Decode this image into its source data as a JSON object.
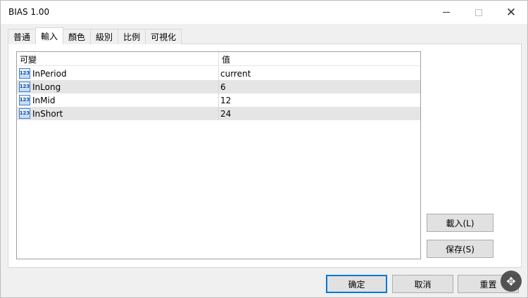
{
  "window": {
    "title": "BIAS 1.00"
  },
  "tabs": [
    {
      "label": "普通"
    },
    {
      "label": "輸入"
    },
    {
      "label": "顏色"
    },
    {
      "label": "級別"
    },
    {
      "label": "比例"
    },
    {
      "label": "可視化"
    }
  ],
  "active_tab": "輸入",
  "grid": {
    "columns": {
      "variable": "可變",
      "value": "值"
    },
    "rows": [
      {
        "icon": "123",
        "name": "InPeriod",
        "value": "current"
      },
      {
        "icon": "123",
        "name": "InLong",
        "value": "6"
      },
      {
        "icon": "123",
        "name": "InMid",
        "value": "12"
      },
      {
        "icon": "123",
        "name": "InShort",
        "value": "24"
      }
    ]
  },
  "side_buttons": {
    "load": "載入(L)",
    "save": "保存(S)"
  },
  "footer_buttons": {
    "ok": "确定",
    "cancel": "取消",
    "reset": "重置"
  },
  "icons": {
    "minimize": "minimize-icon",
    "maximize": "maximize-icon",
    "close": "close-icon",
    "row_type": "integer-type-icon",
    "zoom": "zoom-move-icon"
  },
  "colors": {
    "accent": "#0078d7",
    "row_shade": "#e5e5e5"
  }
}
